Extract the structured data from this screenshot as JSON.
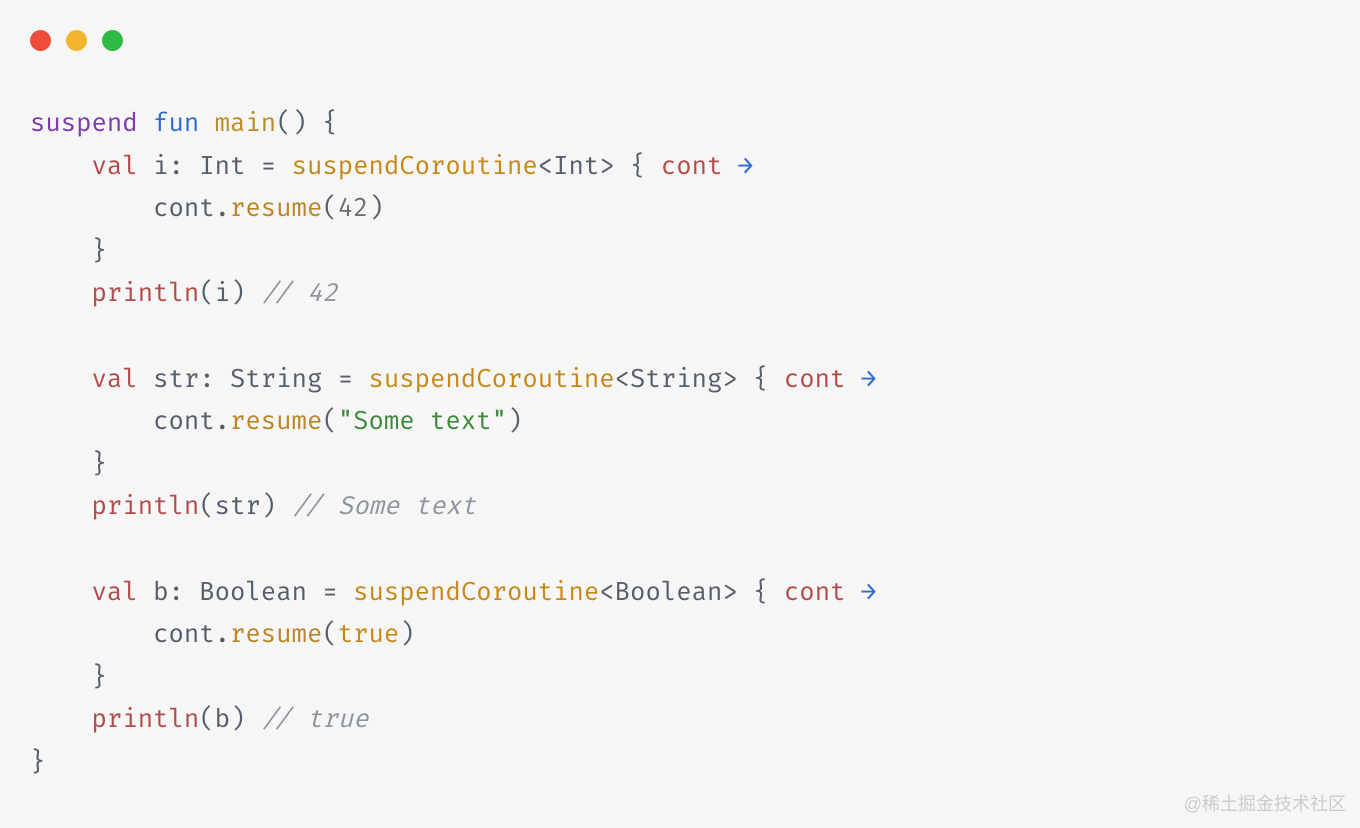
{
  "code": {
    "l1": {
      "suspend": "suspend",
      "fun": "fun",
      "main": "main",
      "paren": "()",
      "brace": " {"
    },
    "l2": {
      "indent": "    ",
      "val": "val",
      "sp1": " ",
      "i": "i",
      "colon": ": ",
      "type": "Int",
      "eq": " = ",
      "call": "suspendCoroutine",
      "lt": "<",
      "gtype": "Int",
      "gt": ">",
      "sp2": " { ",
      "cont": "cont",
      "sp3": " ",
      "arrow": "→"
    },
    "l3": {
      "indent": "        ",
      "cont": "cont",
      "dot": ".",
      "resume": "resume",
      "lp": "(",
      "arg": "42",
      "rp": ")"
    },
    "l4": {
      "indent": "    ",
      "brace": "}"
    },
    "l5": {
      "indent": "    ",
      "println": "println",
      "lp": "(",
      "arg": "i",
      "rp": ")",
      "sp": " ",
      "cmt": "// 42"
    },
    "l7": {
      "indent": "    ",
      "val": "val",
      "sp1": " ",
      "i": "str",
      "colon": ": ",
      "type": "String",
      "eq": " = ",
      "call": "suspendCoroutine",
      "lt": "<",
      "gtype": "String",
      "gt": ">",
      "sp2": " { ",
      "cont": "cont",
      "sp3": " ",
      "arrow": "→"
    },
    "l8": {
      "indent": "        ",
      "cont": "cont",
      "dot": ".",
      "resume": "resume",
      "lp": "(",
      "arg": "\"Some text\"",
      "rp": ")"
    },
    "l9": {
      "indent": "    ",
      "brace": "}"
    },
    "l10": {
      "indent": "    ",
      "println": "println",
      "lp": "(",
      "arg": "str",
      "rp": ")",
      "sp": " ",
      "cmt": "// Some text"
    },
    "l12": {
      "indent": "    ",
      "val": "val",
      "sp1": " ",
      "i": "b",
      "colon": ": ",
      "type": "Boolean",
      "eq": " = ",
      "call": "suspendCoroutine",
      "lt": "<",
      "gtype": "Boolean",
      "gt": ">",
      "sp2": " { ",
      "cont": "cont",
      "sp3": " ",
      "arrow": "→"
    },
    "l13": {
      "indent": "        ",
      "cont": "cont",
      "dot": ".",
      "resume": "resume",
      "lp": "(",
      "arg": "true",
      "rp": ")"
    },
    "l14": {
      "indent": "    ",
      "brace": "}"
    },
    "l15": {
      "indent": "    ",
      "println": "println",
      "lp": "(",
      "arg": "b",
      "rp": ")",
      "sp": " ",
      "cmt": "// true"
    },
    "l16": {
      "brace": "}"
    }
  },
  "watermark": "@稀土掘金技术社区"
}
